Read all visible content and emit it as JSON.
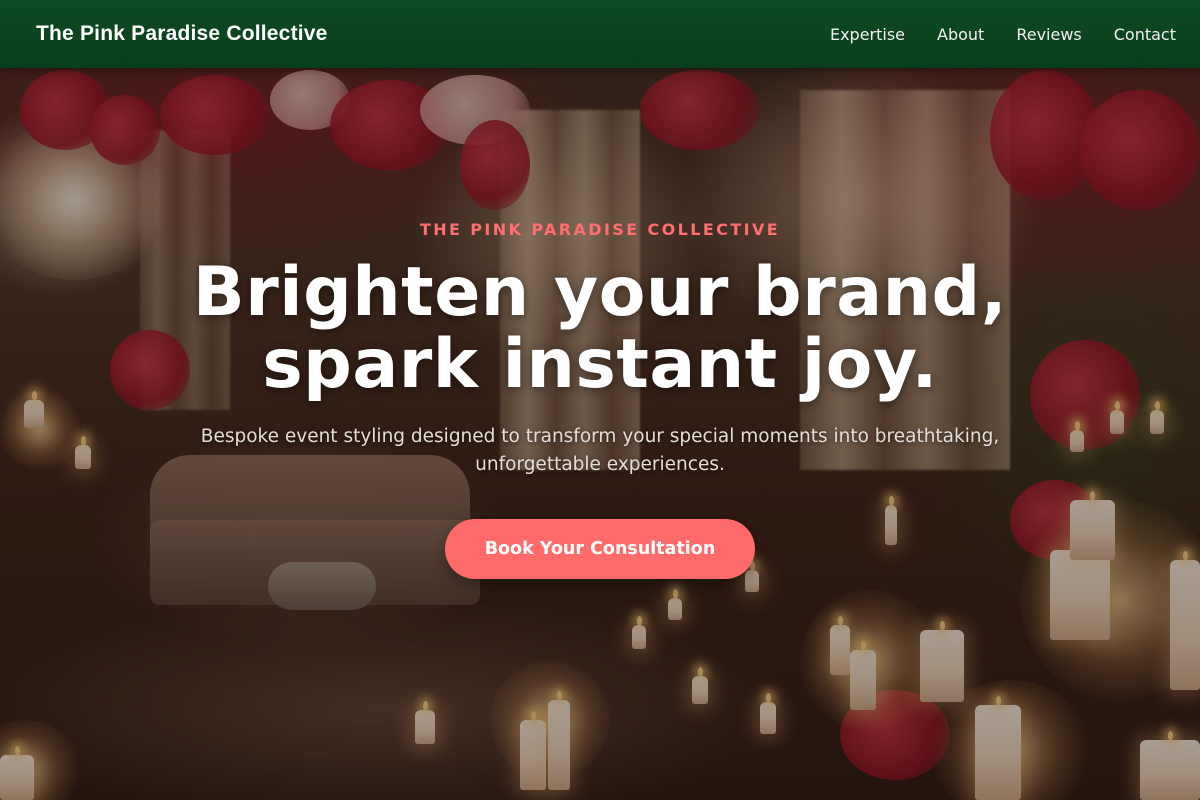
{
  "nav": {
    "brand": "The Pink Paradise Collective",
    "links": [
      "Expertise",
      "About",
      "Reviews",
      "Contact"
    ]
  },
  "hero": {
    "eyebrow": "THE PINK PARADISE COLLECTIVE",
    "headline_line1": "Brighten your brand,",
    "headline_line2": "spark instant joy.",
    "subheadline": "Bespoke event styling designed to transform your special moments into breathtaking, unforgettable experiences.",
    "cta_label": "Book Your Consultation",
    "background_image": "candlelit-floral-event-venue"
  },
  "colors": {
    "nav_background": "#0a3f1c",
    "accent": "#ff6b6b",
    "eyebrow": "#ff6f6f",
    "headline": "#ffffff"
  }
}
